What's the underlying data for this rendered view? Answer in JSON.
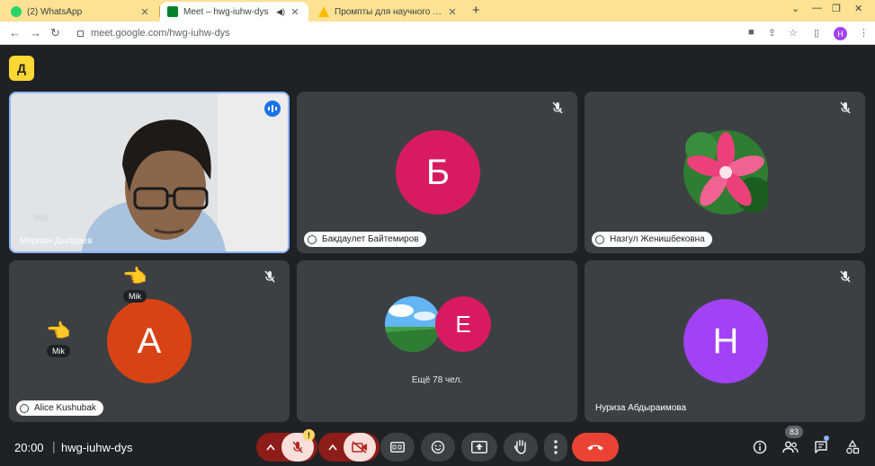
{
  "browser": {
    "tabs": [
      {
        "title": "(2) WhatsApp",
        "favicon_color": "#25d366"
      },
      {
        "title": "Meet – hwg-iuhw-dys",
        "favicon_color": "#00832d"
      },
      {
        "title": "Промпты для научного исслед",
        "favicon_color": "#fbbc04"
      }
    ],
    "new_tab": "+",
    "url": "meet.google.com/hwg-iuhw-dys",
    "profile_initial": "H"
  },
  "meet": {
    "app_logo_text": "Д",
    "tiles": [
      {
        "name": "Мирлан Дылдаев",
        "speaking": true,
        "ghost_label": "Mik"
      },
      {
        "name": "Бакдаулет Байтемиров",
        "avatar_letter": "Б",
        "avatar_color": "#d81b60",
        "muted": true
      },
      {
        "name": "Назгул Женишбековна",
        "muted": true
      },
      {
        "name": "Alice Kushubak",
        "avatar_letter": "A",
        "avatar_color": "#d84315",
        "muted": true,
        "reactions": [
          {
            "emoji": "👈",
            "label": "Mik"
          },
          {
            "emoji": "👈",
            "label": "Mik"
          }
        ]
      },
      {
        "more_label": "Ещё 78 чел.",
        "avatar_letter": "E",
        "avatar_color": "#d81b60"
      },
      {
        "name": "Нуриза Абдыраимова",
        "avatar_letter": "Н",
        "avatar_color": "#a142f4",
        "muted": true
      }
    ]
  },
  "bottom_bar": {
    "time": "20:00",
    "separator": "|",
    "meeting_code": "hwg-iuhw-dys",
    "mic_warning": "!",
    "people_count": "83"
  },
  "colors": {
    "background": "#202124",
    "tile": "#3c4043",
    "end_call": "#ea4335",
    "accent": "#8ab4f8"
  }
}
